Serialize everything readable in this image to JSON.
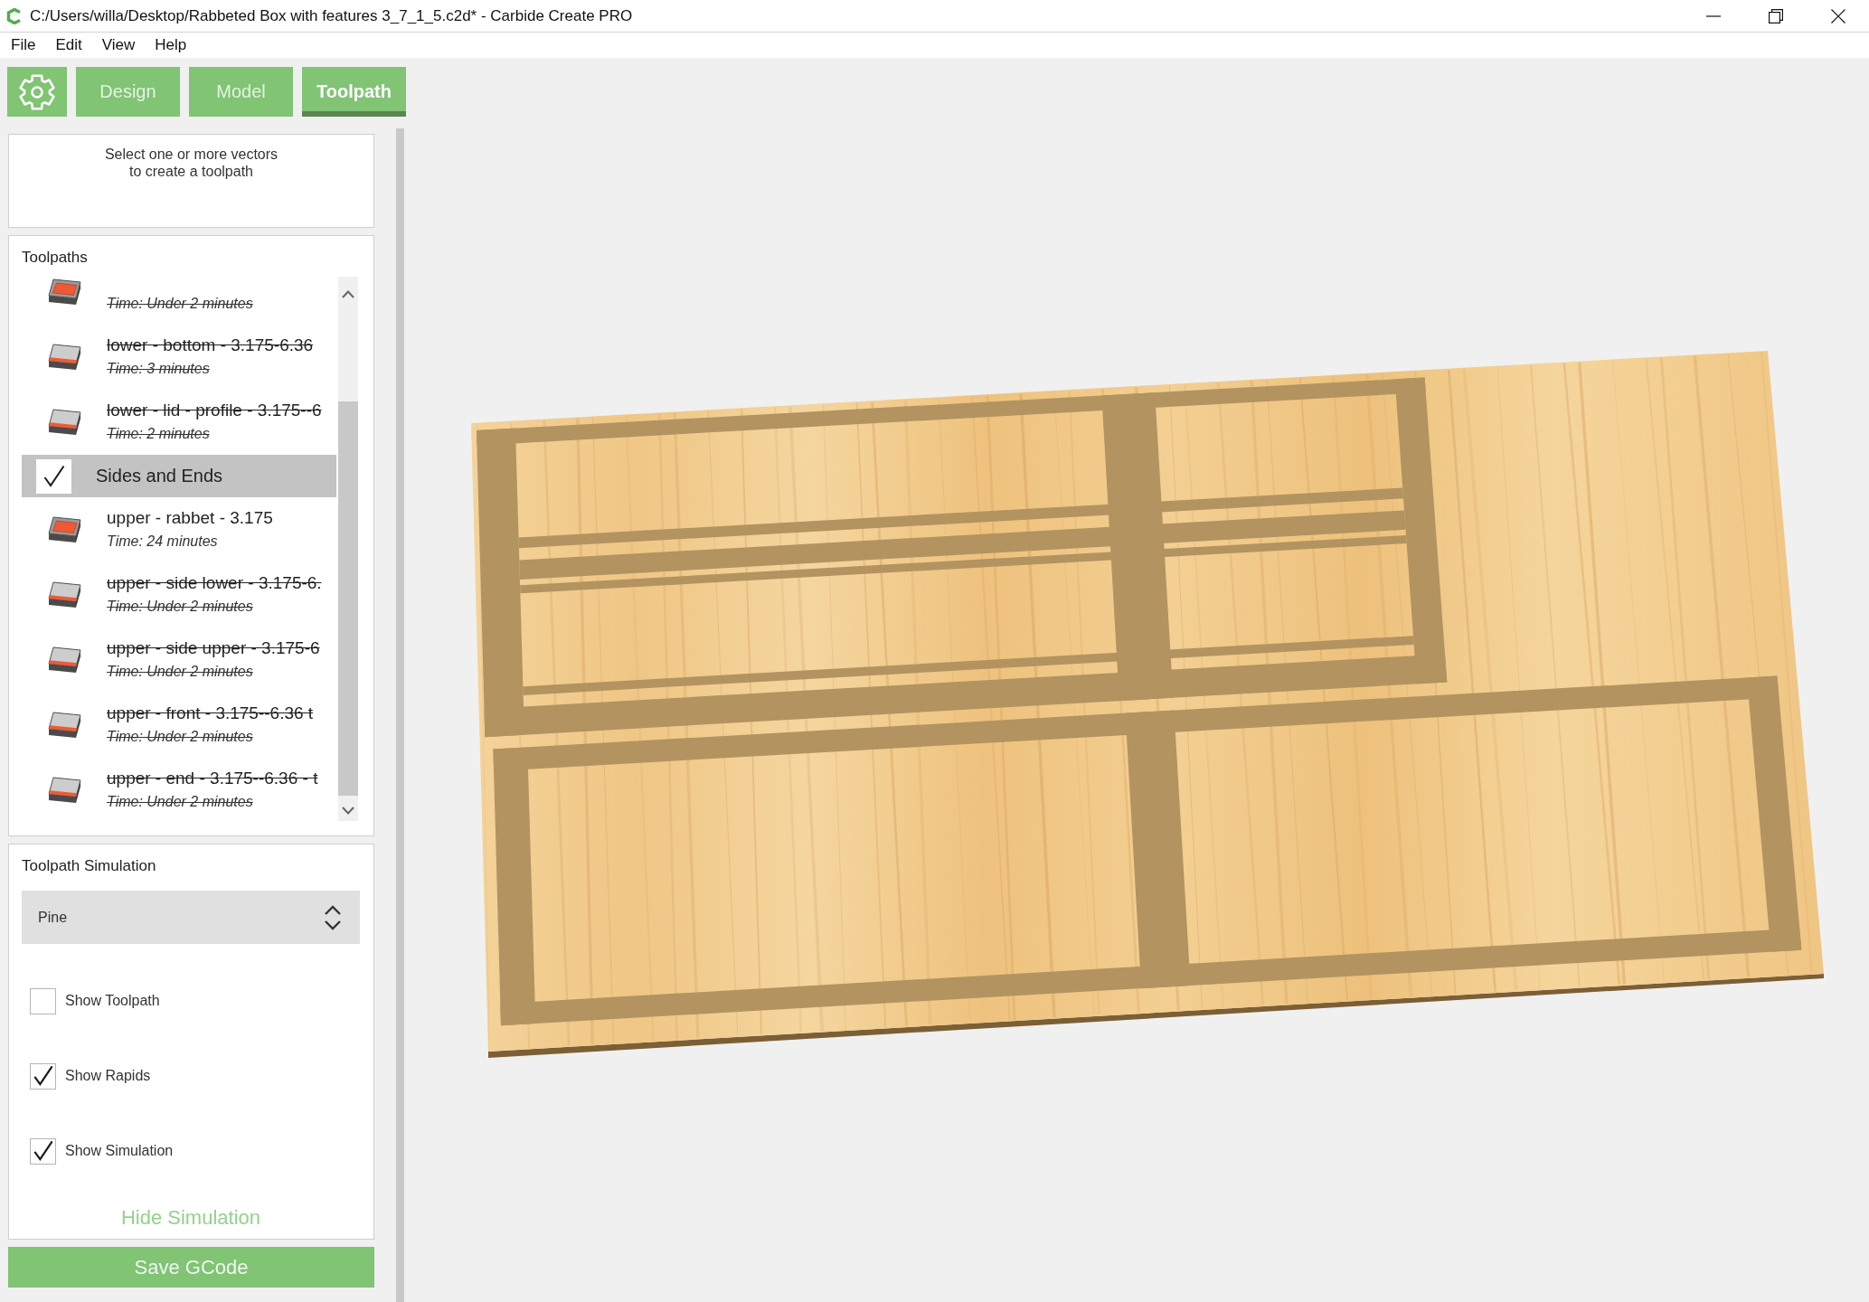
{
  "window": {
    "title": "C:/Users/willa/Desktop/Rabbeted Box with features 3_7_1_5.c2d* - Carbide Create PRO"
  },
  "menu": [
    "File",
    "Edit",
    "View",
    "Help"
  ],
  "mode_tabs": [
    {
      "label": "Design",
      "selected": false
    },
    {
      "label": "Model",
      "selected": false
    },
    {
      "label": "Toolpath",
      "selected": true
    }
  ],
  "hint": "Select one or more vectors\nto create a toolpath",
  "toolpaths": {
    "title": "Toolpaths",
    "items": [
      {
        "kind": "pocket",
        "time": "Time: Under 2 minutes",
        "disabled": true
      },
      {
        "kind": "contour",
        "name": "lower - bottom - 3.175-6.36",
        "time": "Time: 3 minutes",
        "disabled": true
      },
      {
        "kind": "contour",
        "name": "lower - lid - profile - 3.175--6",
        "time": "Time: 2 minutes",
        "disabled": true
      },
      {
        "kind": "group",
        "name": "Sides and Ends",
        "checked": true
      },
      {
        "kind": "pocket",
        "name": "upper - rabbet - 3.175",
        "time": "Time: 24 minutes",
        "disabled": false
      },
      {
        "kind": "contour",
        "name": "upper - side lower - 3.175-6.",
        "time": "Time: Under 2 minutes",
        "disabled": true
      },
      {
        "kind": "contour",
        "name": "upper - side upper - 3.175-6",
        "time": "Time: Under 2 minutes",
        "disabled": true
      },
      {
        "kind": "contour",
        "name": "upper - front - 3.175--6.36 t",
        "time": "Time: Under 2 minutes",
        "disabled": true
      },
      {
        "kind": "contour",
        "name": "upper - end - 3.175--6.36 - t",
        "time": "Time: Under 2 minutes",
        "disabled": true
      }
    ]
  },
  "simulation": {
    "title": "Toolpath Simulation",
    "material": "Pine",
    "options": [
      {
        "label": "Show Toolpath",
        "checked": false
      },
      {
        "label": "Show Rapids",
        "checked": true
      },
      {
        "label": "Show Simulation",
        "checked": true
      }
    ],
    "hide_link": "Hide Simulation"
  },
  "save_button": "Save GCode"
}
